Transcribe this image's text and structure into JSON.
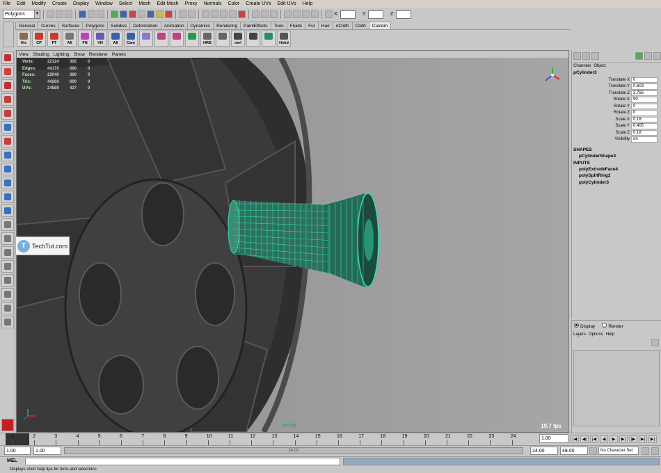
{
  "menubar": [
    "File",
    "Edit",
    "Modify",
    "Create",
    "Display",
    "Window",
    "Select",
    "Mesh",
    "Edit Mesh",
    "Proxy",
    "Normals",
    "Color",
    "Create UVs",
    "Edit UVs",
    "Help"
  ],
  "status": {
    "mode": "Polygons",
    "x_label": "X:",
    "y_label": "Y:",
    "z_label": "Z:"
  },
  "shelf_tabs": [
    "General",
    "Curves",
    "Surfaces",
    "Polygons",
    "Subdivs",
    "Deformation",
    "Animation",
    "Dynamics",
    "Rendering",
    "PaintEffects",
    "Toon",
    "Fluids",
    "Fur",
    "Hair",
    "nCloth",
    "Cloth",
    "Custom"
  ],
  "shelf_active_tab": "Custom",
  "shelf_buttons": [
    {
      "label": "His",
      "color": "#8a6a4a"
    },
    {
      "label": "CP",
      "color": "#c83a2a"
    },
    {
      "label": "FT",
      "color": "#c83a2a"
    },
    {
      "label": "All",
      "color": "#777"
    },
    {
      "label": "FN",
      "color": "#c040c0"
    },
    {
      "label": "VN",
      "color": "#6a5ab0"
    },
    {
      "label": "All",
      "color": "#3a60a8"
    },
    {
      "label": "Cam",
      "color": "#3a60a8"
    },
    {
      "label": "",
      "color": "#8a7ac8"
    },
    {
      "label": "",
      "color": "#c04080"
    },
    {
      "label": "",
      "color": "#c04080"
    },
    {
      "label": "",
      "color": "#2a9a4a"
    },
    {
      "label": "HRB",
      "color": "#666"
    },
    {
      "label": "",
      "color": "#666"
    },
    {
      "label": "mel",
      "color": "#444"
    },
    {
      "label": "",
      "color": "#444"
    },
    {
      "label": "",
      "color": "#2a8a6a"
    },
    {
      "label": "Hshd",
      "color": "#555"
    }
  ],
  "viewport": {
    "menu": [
      "View",
      "Shading",
      "Lighting",
      "Show",
      "Renderer",
      "Panels"
    ],
    "hud": [
      {
        "k": "Verts:",
        "a": "22124",
        "b": "302",
        "c": "0"
      },
      {
        "k": "Edges:",
        "a": "44170",
        "b": "660",
        "c": "0"
      },
      {
        "k": "Faces:",
        "a": "22040",
        "b": "360",
        "c": "0"
      },
      {
        "k": "Tris:",
        "a": "44260",
        "b": "600",
        "c": "0"
      },
      {
        "k": "UVs:",
        "a": "24589",
        "b": "427",
        "c": "0"
      }
    ],
    "camera": "persp",
    "fps": "19.7 fps"
  },
  "logo": {
    "text": "TechTut.com",
    "badge": "T"
  },
  "channel_box": {
    "tabs": [
      "Channels",
      "Object"
    ],
    "object": "pCylinder3",
    "attrs": [
      {
        "name": "Translate X",
        "value": "0"
      },
      {
        "name": "Translate Y",
        "value": "0.603"
      },
      {
        "name": "Translate Z",
        "value": "2.756"
      },
      {
        "name": "Rotate X",
        "value": "90"
      },
      {
        "name": "Rotate Y",
        "value": "0"
      },
      {
        "name": "Rotate Z",
        "value": "0"
      },
      {
        "name": "Scale X",
        "value": "0.18"
      },
      {
        "name": "Scale Y",
        "value": "0.405"
      },
      {
        "name": "Scale Z",
        "value": "0.18"
      },
      {
        "name": "Visibility",
        "value": "on"
      }
    ],
    "shapes_label": "SHAPES",
    "shape": "pCylinderShape3",
    "inputs_label": "INPUTS",
    "inputs": [
      "polyExtrudeFace4",
      "polySplitRing2",
      "polyCylinder3"
    ]
  },
  "layer_editor": {
    "display": "Display",
    "render": "Render",
    "menu": [
      "Layers",
      "Options",
      "Help"
    ]
  },
  "timeline": {
    "ticks": [
      "1",
      "2",
      "3",
      "4",
      "5",
      "6",
      "7",
      "8",
      "9",
      "10",
      "11",
      "12",
      "13",
      "14",
      "15",
      "16",
      "17",
      "18",
      "19",
      "20",
      "21",
      "22",
      "23",
      "24"
    ],
    "current": "1.00"
  },
  "range": {
    "start": "1.00",
    "start2": "1.00",
    "end": "24.00",
    "end2": "48.00",
    "bar_label": "24.00",
    "character_set": "No Character Set"
  },
  "mel": {
    "label": "MEL"
  },
  "help_line": "Displays short help tips for tools and selections"
}
